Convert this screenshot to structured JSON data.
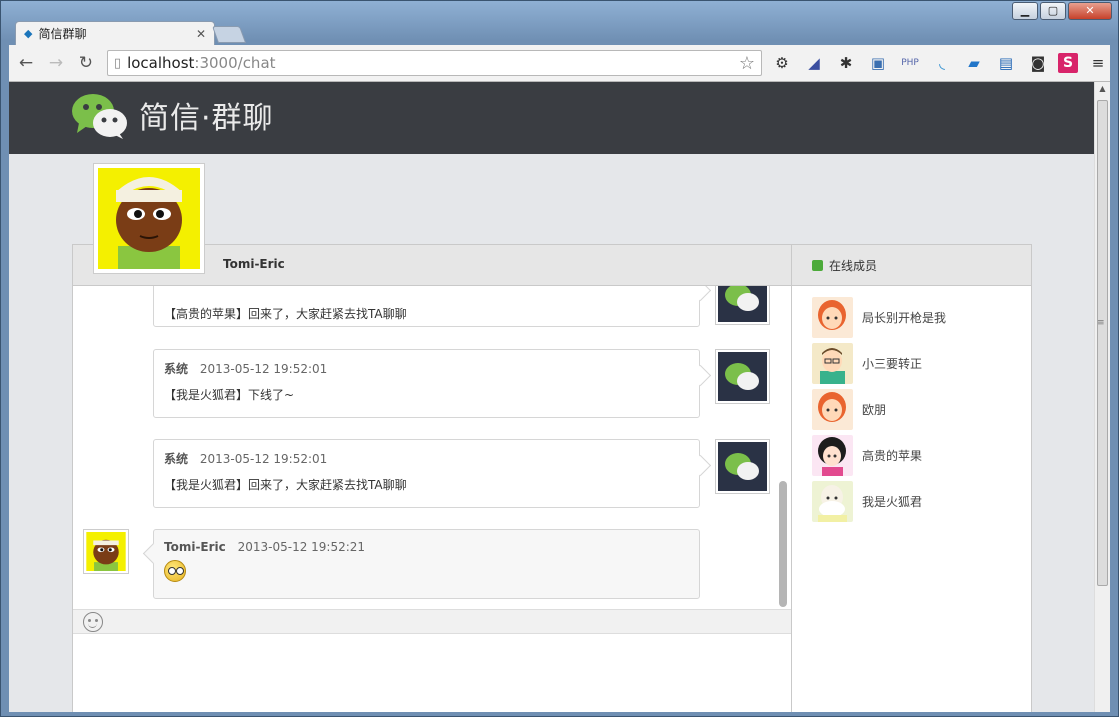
{
  "browser": {
    "tab_title": "简信群聊",
    "url_host": "localhost",
    "url_path": ":3000/chat",
    "window_controls": [
      "minimize",
      "maximize",
      "close"
    ]
  },
  "app": {
    "title": "简信·群聊",
    "chat_title": "Tomi-Eric",
    "members_title": "在线成员"
  },
  "messages": [
    {
      "sender": "",
      "time": "",
      "text": "【高贵的苹果】回来了，大家赶紧去找TA聊聊",
      "side": "system"
    },
    {
      "sender": "系统",
      "time": "2013-05-12 19:52:01",
      "text": "【我是火狐君】下线了~",
      "side": "system"
    },
    {
      "sender": "系统",
      "time": "2013-05-12 19:52:01",
      "text": "【我是火狐君】回来了，大家赶紧去找TA聊聊",
      "side": "system"
    },
    {
      "sender": "Tomi-Eric",
      "time": "2013-05-12 19:52:21",
      "text": "",
      "side": "me",
      "emoji": "surprised-emoji"
    }
  ],
  "members": [
    {
      "name": "局长别开枪是我",
      "color": "#f6c9a8"
    },
    {
      "name": "小三要转正",
      "color": "#6cc6a0"
    },
    {
      "name": "欧朋",
      "color": "#f6c9a8"
    },
    {
      "name": "高贵的苹果",
      "color": "#f7e2f0"
    },
    {
      "name": "我是火狐君",
      "color": "#e8efc8"
    }
  ],
  "colors": {
    "header_bg": "#3a3d42",
    "online": "#4caa3a",
    "wechat_green": "#7bbf4a"
  }
}
